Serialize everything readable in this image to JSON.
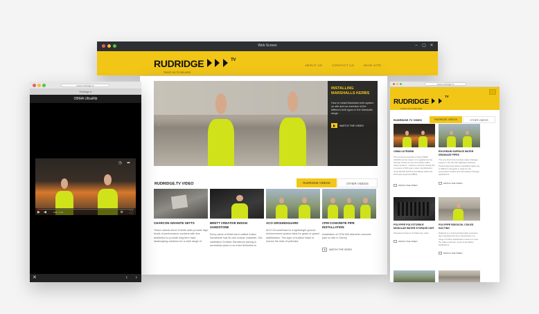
{
  "desktop": {
    "window_title": "Web Screen",
    "logo_text": "RUDRIDGE",
    "logo_suffix": "TV",
    "tagline": "TRUST US TO DELIVER",
    "nav": [
      "ABOUT US",
      "CONTACT US",
      "MAIN SITE"
    ]
  },
  "phone_left": {
    "url": "www.rudridge.tv",
    "tab_label": "Rudridge.tv",
    "header": "OBMA UltraRib",
    "time": "0:01 / 1:15"
  },
  "main": {
    "url": "www.rudridge.tv",
    "hero": {
      "title": "INSTALLING MARSHALLS KERBS",
      "text": "How to install Marshalls kerb system on site and an overview of the different kerb types in the Marshalls range.",
      "watch": "WATCH THE VIDEO"
    },
    "section_title": "RUDRIDGE.TV VIDEO",
    "tabs": [
      "RUDRIDGE VIDEOS",
      "OTHER VIDEOS"
    ],
    "cards": [
      {
        "title": "CHARCON GRANITE SETTS",
        "text": "These natural stone Granite setts provide high levels of performance combine with fine aesthetics to provide long term hard landscaping solutions for a wide range of",
        "watch": ""
      },
      {
        "title": "BRETT CREATIVE INDIAN SANDSTONE",
        "text": "Every piece of Brett hand crafted Indian Sandstone has its own unique character. Our calibrated Creative Sandstone paving is accurately sawn to an even thickness to",
        "watch": ""
      },
      {
        "title": "ACO GROUNDGUARD",
        "text": "ACO GroundGuard is a lightweight ground reinforcement system ideal for grass or gravel stabilisation. This type of surface helps to reduce the risks of potholes,",
        "watch": ""
      },
      {
        "title": "CPM CONCRETE PIPE INSTALLATION",
        "text": "Installation of CPM 525 diameter concrete pipe on site in Surrey.",
        "watch": "WATCH THE VIDEO"
      }
    ]
  },
  "phone_right": {
    "url": "www.rudridge.tv",
    "logo_text": "RUDRIDGE",
    "logo_suffix": "TV",
    "tagline": "TRUST US TO DELIVER",
    "section_title": "RUDRIDGE.TV VIDEO",
    "tabs": [
      "RUDRIDGE VIDEOS",
      "OTHER VIDEOS"
    ],
    "cards": [
      {
        "title": "OSMA ULTRARIB",
        "text": "The numerous benefits of using OSMA UltraRib are the reason it is regarded as the ultimate choice for foul and surface water sewer systems – having a minimum design life in excess of 100 years, pipes manufactured under BS EN 13476-3 and fittings which are third party approved (BBA).",
        "watch": "WATCH THE VIDEO"
      },
      {
        "title": "ROOGRAIN SURFACE WATER DRAINAGE PIPES",
        "text": "The only first formed surface water drainage system in the UK with Highways Authority Product Approval Scheme (HAPAS) status (up to 600mm). Roograin is used for non-pressurised surface and sub-surface drainage applications.",
        "watch": "WATCH THE VIDEO"
      },
      {
        "title": "POLYPIPE POLYSTORM-R MODULAR WATER STORAGE UNIT",
        "text": "Polyplase Polystorm R Stationary Cube.",
        "watch": "WATCH THE VIDEO"
      },
      {
        "title": "POLYPIPE RIDGICOIL COILED DUCTING",
        "text": "Ridgicoil is a coiled twinwall cable protection duct manufactured from polyethylene in a range of NJUG classification colours to meet the cable protection needs of all utilities applications.",
        "watch": "WATCH THE VIDEO"
      }
    ]
  },
  "colors": {
    "brand_yellow": "#f2c617",
    "dark": "#2d2f33"
  }
}
